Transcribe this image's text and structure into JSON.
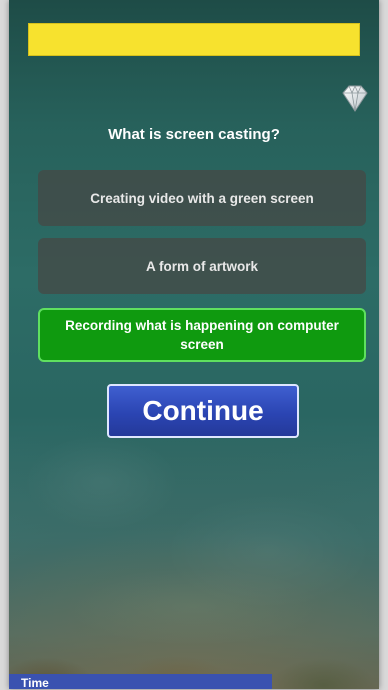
{
  "progress": {
    "fraction": 1.0,
    "color": "#f7e22e"
  },
  "gem_icon": "diamond-icon",
  "question": "What is screen casting?",
  "answers": [
    {
      "label": "Creating video with a green screen",
      "state": "neutral"
    },
    {
      "label": "A form of artwork",
      "state": "neutral"
    },
    {
      "label": "Recording what is happening on computer screen",
      "state": "correct"
    }
  ],
  "continue_label": "Continue",
  "timer": {
    "label": "Time",
    "fraction": 0.71
  },
  "colors": {
    "correct": "#0f9a0f",
    "neutral": "#464644",
    "button": "#2b45b3",
    "timer": "#3a52b0"
  }
}
